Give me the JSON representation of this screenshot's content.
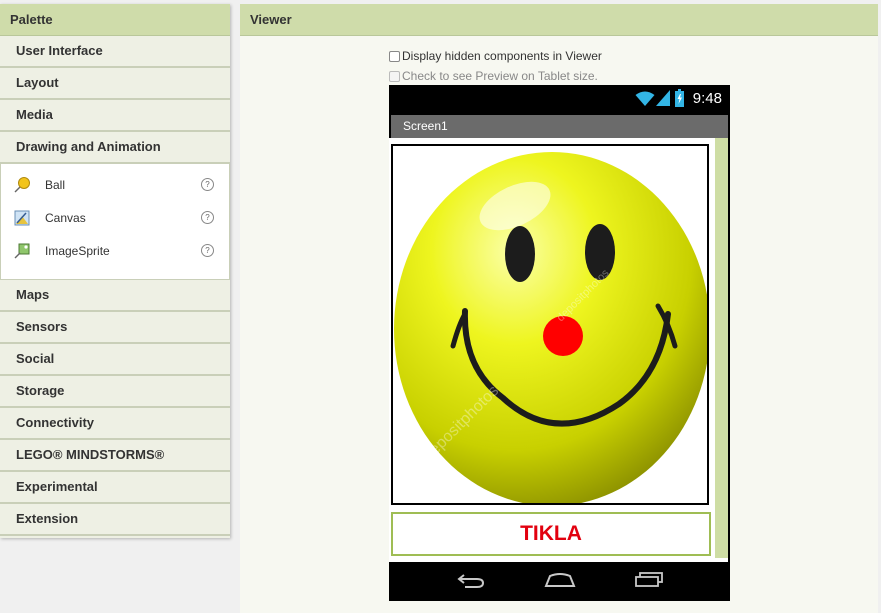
{
  "palette": {
    "title": "Palette",
    "categories_top": [
      "User Interface",
      "Layout",
      "Media",
      "Drawing and Animation"
    ],
    "components": [
      {
        "label": "Ball",
        "icon": "ball-icon",
        "help": "?"
      },
      {
        "label": "Canvas",
        "icon": "canvas-icon",
        "help": "?"
      },
      {
        "label": "ImageSprite",
        "icon": "imagesprite-icon",
        "help": "?"
      }
    ],
    "categories_bottom": [
      "Maps",
      "Sensors",
      "Social",
      "Storage",
      "Connectivity",
      "LEGO® MINDSTORMS®",
      "Experimental",
      "Extension"
    ]
  },
  "viewer": {
    "title": "Viewer",
    "display_hidden": "Display hidden components in Viewer",
    "tablet_preview": "Check to see Preview on Tablet size."
  },
  "phone": {
    "time": "9:48",
    "screen_title": "Screen1",
    "button_label": "TIKLA",
    "watermark": "depositphotos",
    "status_icons": [
      "wifi-icon",
      "signal-icon",
      "battery-icon"
    ],
    "nav_icons": [
      "back-icon",
      "home-icon",
      "recent-apps-icon"
    ]
  },
  "colors": {
    "header_bg": "#cfdcaa",
    "button_text": "#e2000f",
    "button_border": "#9fbd54",
    "status_icons": "#33b5e5"
  }
}
